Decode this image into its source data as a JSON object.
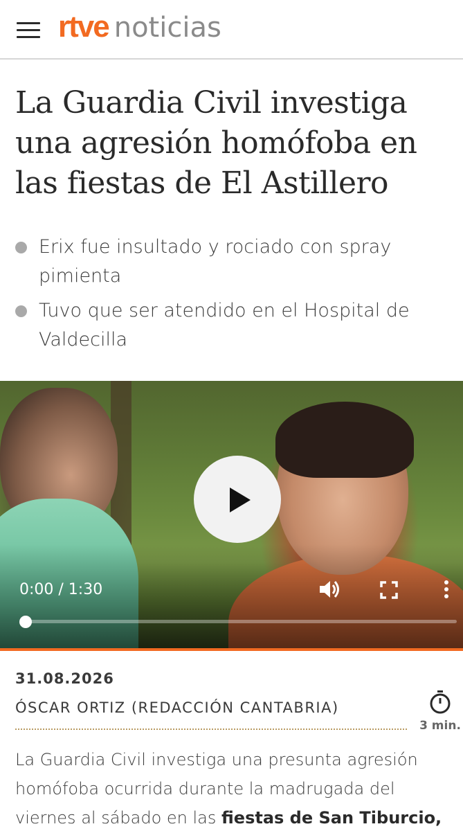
{
  "header": {
    "brand": "rtve",
    "section": "noticias",
    "menu_icon": "hamburger-menu-icon"
  },
  "article": {
    "headline": "La Guardia Civil investiga una agresión homófoba en las fiestas de El Astillero",
    "bullets": [
      "Erix fue insultado y rociado con spray pimienta",
      "Tuvo que ser atendido en el Hospital de Valdecilla"
    ],
    "video": {
      "time": "0:00 / 1:30",
      "progress": 0.0,
      "icons": [
        "play-icon",
        "volume-icon",
        "fullscreen-icon",
        "more-options-icon"
      ]
    },
    "date": "31.08.2026",
    "author": "ÓSCAR ORTIZ (REDACCIÓN CANTABRIA)",
    "read_time": "3 min.",
    "body_start": "La Guardia Civil investiga una presunta agresión homófoba ocurrida durante la madrugada del viernes al sábado en las ",
    "body_link": "fiestas de San Tiburcio, en"
  },
  "colors": {
    "brand_orange": "#f26a21",
    "text": "#2a2a2a",
    "bullet_dot": "#a9a9a9",
    "divider": "#b89a62"
  }
}
